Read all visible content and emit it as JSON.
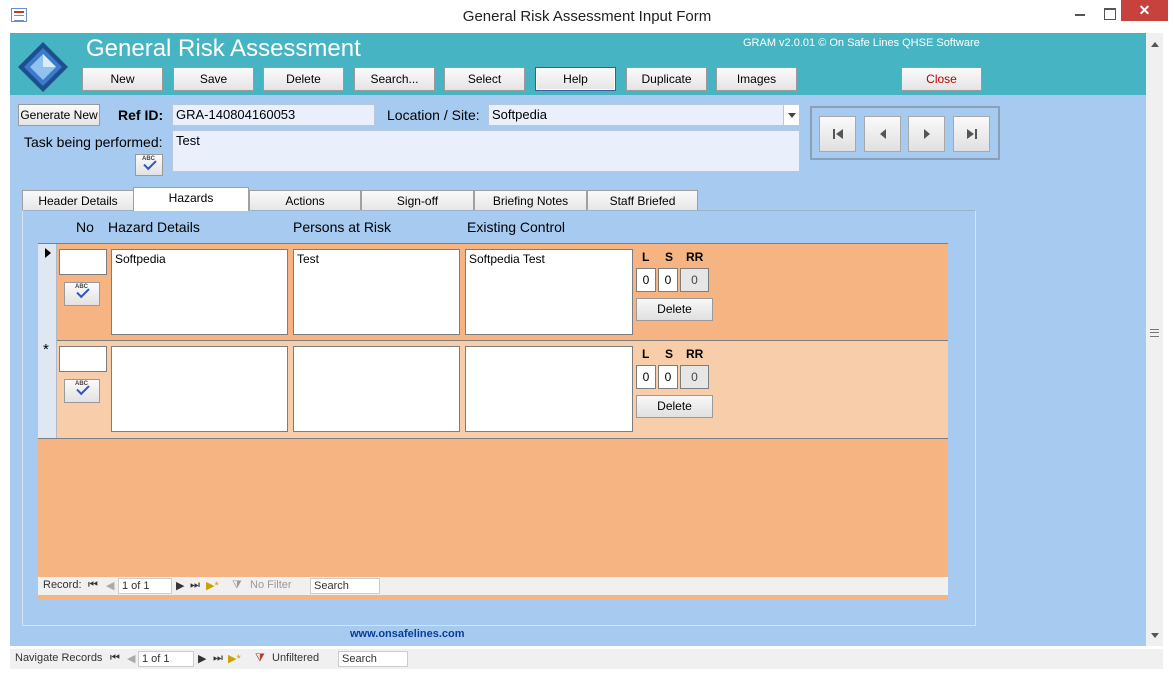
{
  "window": {
    "title": "General Risk Assessment Input Form",
    "close_symbol": "✕"
  },
  "header": {
    "app_title": "General Risk Assessment",
    "version": "GRAM v2.0.01 © On Safe Lines QHSE Software"
  },
  "toolbar": {
    "new": "New",
    "save": "Save",
    "delete": "Delete",
    "search": "Search...",
    "select": "Select",
    "help": "Help",
    "duplicate": "Duplicate",
    "images": "Images",
    "close": "Close"
  },
  "record": {
    "generate_new": "Generate New",
    "ref_id_label": "Ref ID:",
    "ref_id_value": "GRA-140804160053",
    "location_label": "Location / Site:",
    "location_value": "Softpedia",
    "task_label": "Task being performed:",
    "task_value": "Test"
  },
  "tabs": [
    "Header Details",
    "Hazards",
    "Actions",
    "Sign-off",
    "Briefing Notes",
    "Staff Briefed"
  ],
  "hazard_columns": {
    "no": "No",
    "details": "Hazard Details",
    "persons": "Persons at Risk",
    "control": "Existing Control"
  },
  "hazard_rows": [
    {
      "no": "",
      "details": "Softpedia",
      "persons": "Test",
      "control": "Softpedia Test",
      "l": "0",
      "s": "0",
      "rr": "0",
      "delete": "Delete"
    },
    {
      "no": "",
      "details": "",
      "persons": "",
      "control": "",
      "l": "0",
      "s": "0",
      "rr": "0",
      "delete": "Delete"
    }
  ],
  "risk_labels": {
    "l": "L",
    "s": "S",
    "rr": "RR"
  },
  "subform_nav": {
    "label": "Record:",
    "position": "1 of 1",
    "filter": "No Filter",
    "search": "Search"
  },
  "form_nav": {
    "label": "Navigate Records",
    "position": "1 of 1",
    "filter": "Unfiltered",
    "search": "Search"
  },
  "footer": {
    "website": "www.onsafelines.com"
  }
}
